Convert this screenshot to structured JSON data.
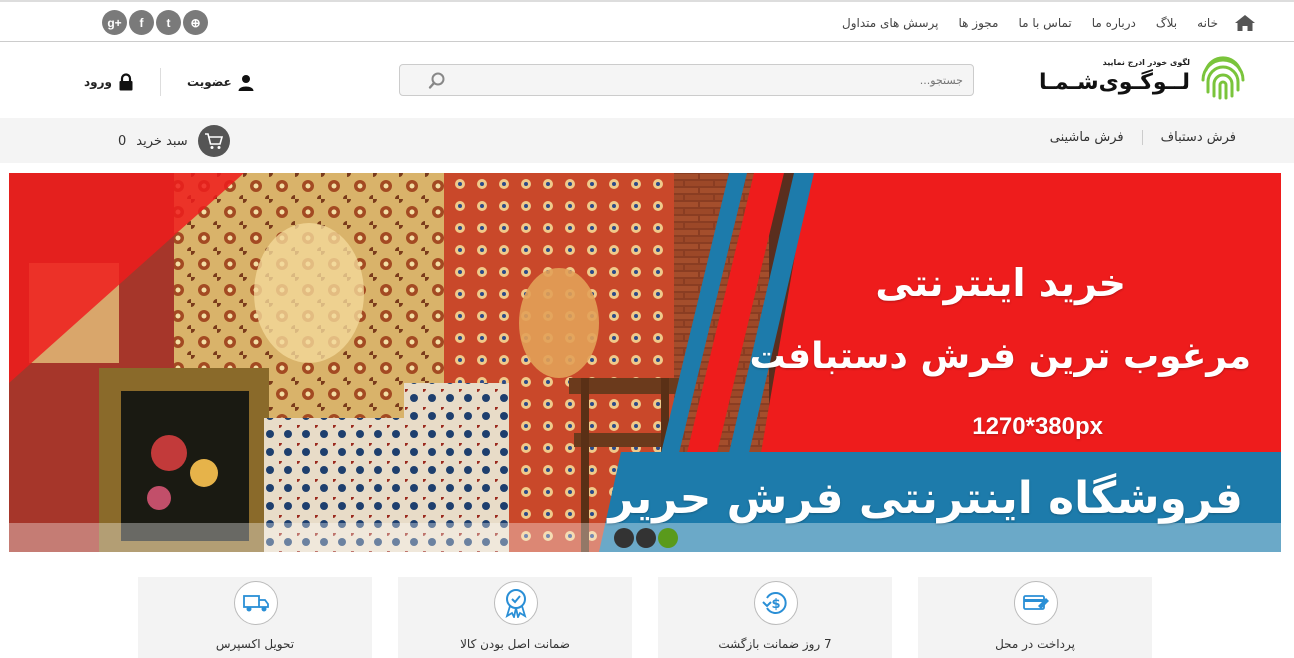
{
  "top_nav": {
    "items": [
      "خانه",
      "بلاگ",
      "درباره ما",
      "تماس با ما",
      "مجوز ها",
      "پرسش های متداول"
    ],
    "social": [
      "google-plus-icon",
      "facebook-icon",
      "twitter-icon",
      "dribbble-icon"
    ],
    "social_glyphs": [
      "g+",
      "f",
      "t",
      "⊕"
    ]
  },
  "logo": {
    "tagline": "لگوی خودر ادرج نمایید",
    "name": "لــوگـوی‌شـمـا"
  },
  "search": {
    "placeholder": "جستجو..."
  },
  "auth": {
    "register": "عضویت",
    "login": "ورود"
  },
  "categories": [
    "فرش دستباف",
    "فرش ماشینی"
  ],
  "cart": {
    "label": "سبد خرید",
    "count": "0"
  },
  "banner": {
    "line1": "خرید اینترنتی",
    "line2": "مرغوب ترین فرش دستبافت",
    "line3": "1270*380px",
    "line4": "فروشگاه اینترنتی فرش حریر",
    "slides": 3,
    "active_slide": 3
  },
  "features": [
    {
      "label": "پرداخت در محل",
      "icon": "card-payment-icon"
    },
    {
      "label": "7 روز ضمانت بازگشت",
      "icon": "money-back-icon"
    },
    {
      "label": "ضمانت اصل بودن کالا",
      "icon": "quality-badge-icon"
    },
    {
      "label": "تحویل اکسپرس",
      "icon": "delivery-truck-icon"
    }
  ],
  "colors": {
    "banner_red": "#ee1c1c",
    "banner_blue": "#1d7bab",
    "logo_green": "#7ac43b",
    "icon_blue": "#2a8fd6"
  }
}
